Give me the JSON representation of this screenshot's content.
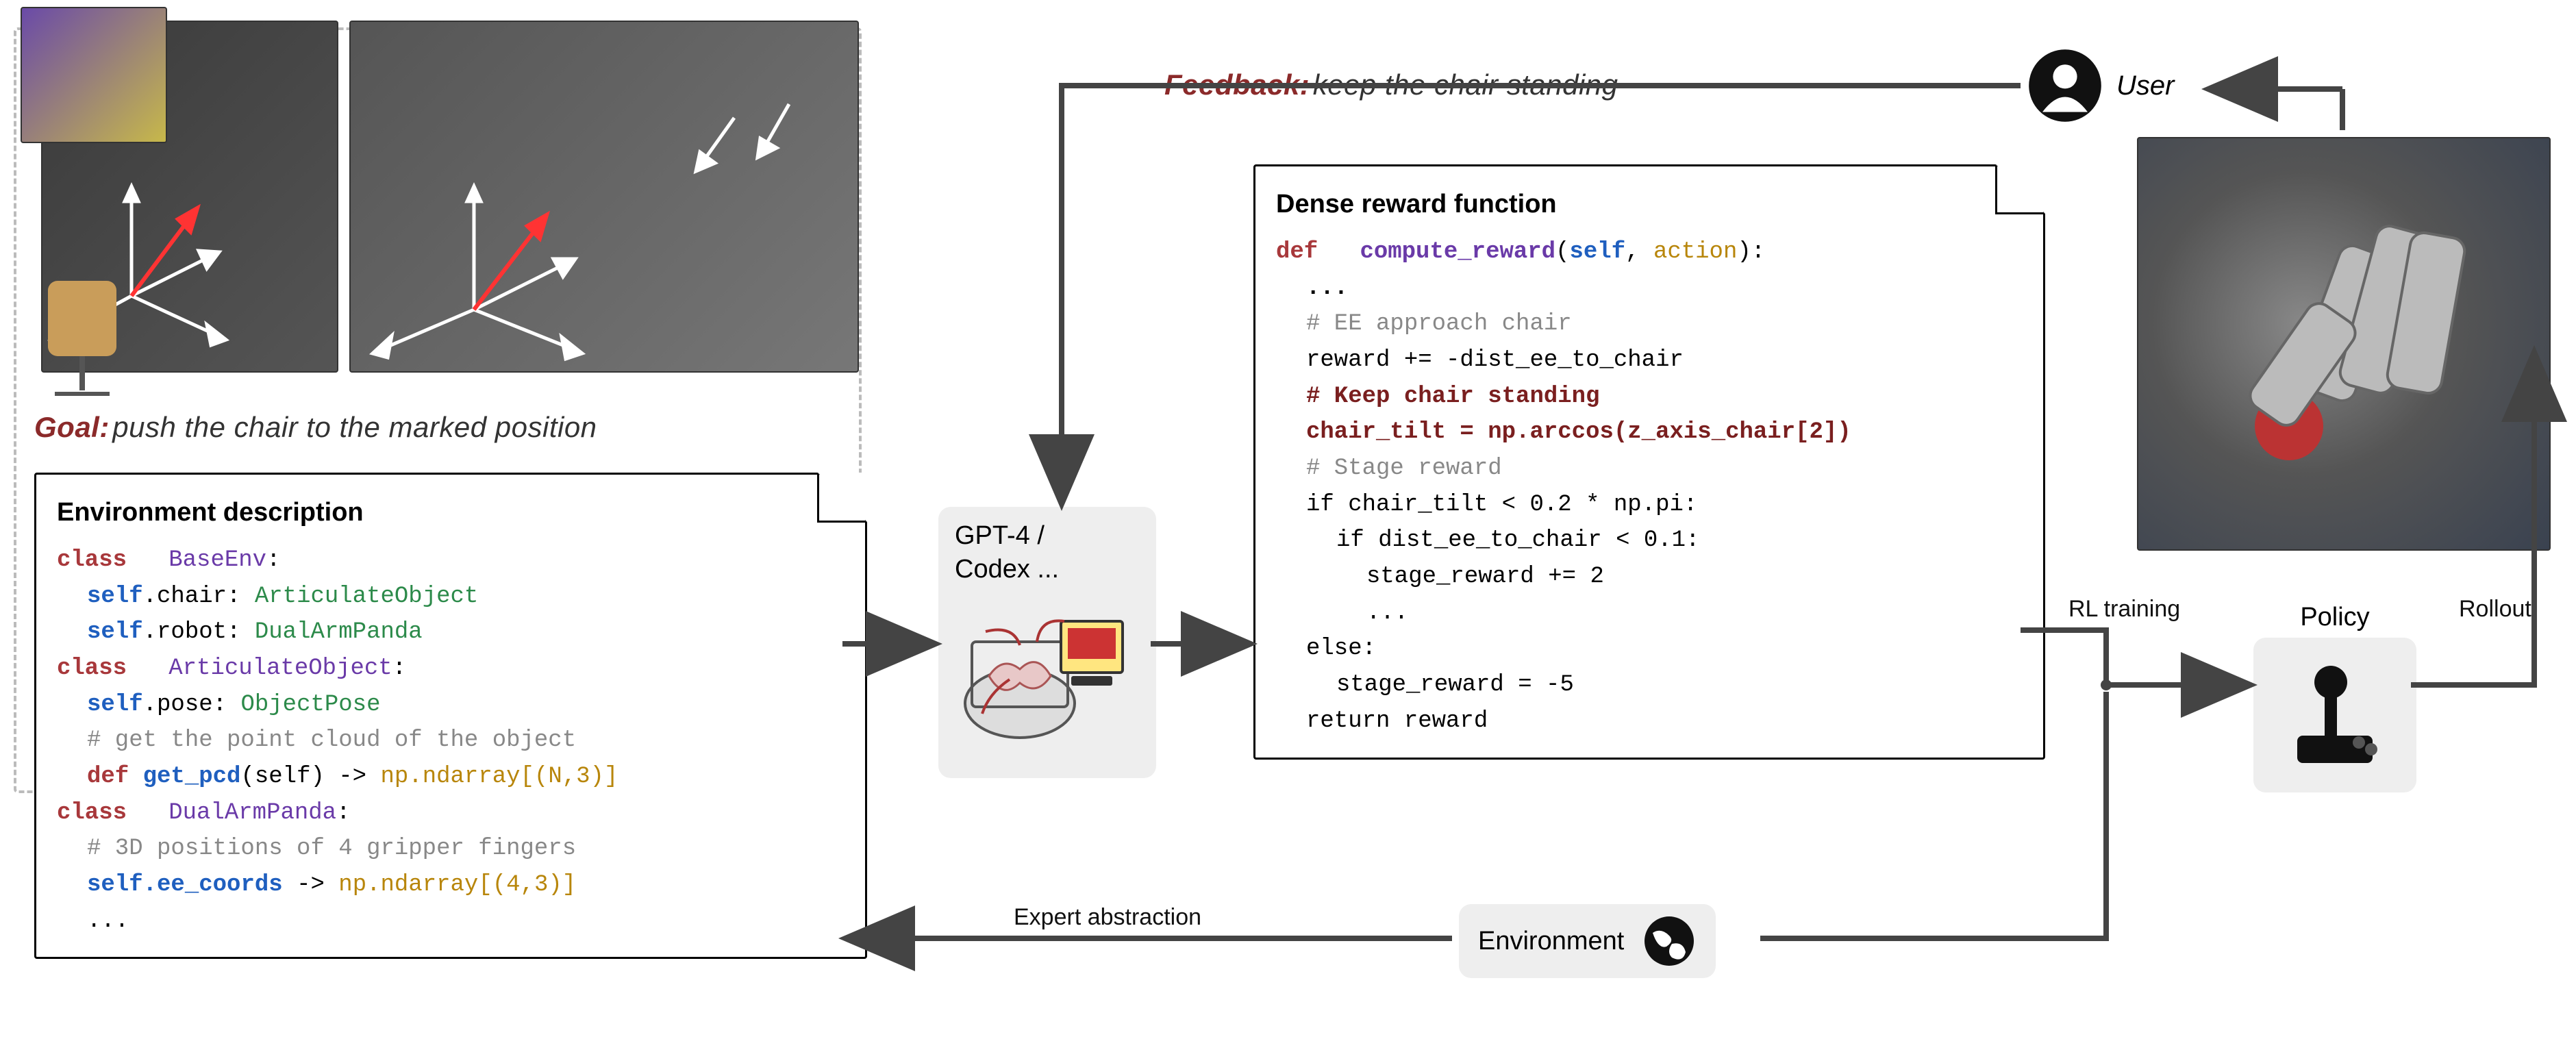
{
  "goal": {
    "label": "Goal:",
    "text": "push the chair to the marked position"
  },
  "feedback": {
    "label": "Feedback:",
    "text": "keep the chair standing"
  },
  "user_label": "User",
  "llm_box": {
    "text": "GPT-4 /\nCodex ..."
  },
  "env_label": "Environment",
  "policy_label": "Policy",
  "rl_label": "RL training",
  "rollout_label": "Rollout",
  "expert_label": "Expert abstraction",
  "env_card": {
    "title": "Environment description",
    "l1_kw": "class",
    "l1_name": "BaseEnv",
    "l1_colon": ":",
    "l2_self": "self",
    "l2_attr": ".chair:",
    "l2_type": "ArticulateObject",
    "l3_self": "self",
    "l3_attr": ".robot:",
    "l3_type": "DualArmPanda",
    "l4_kw": "class",
    "l4_name": "ArticulateObject",
    "l4_colon": ":",
    "l5_self": "self",
    "l5_attr": ".pose:",
    "l5_type": "ObjectPose",
    "l6_comment": "# get the point cloud of the object",
    "l7_def": "def",
    "l7_fn": "get_pcd",
    "l7_args": "(self)",
    "l7_arrow": " -> ",
    "l7_ret": "np.ndarray[(N,3)]",
    "l8_kw": "class",
    "l8_name": "DualArmPanda",
    "l8_colon": ":",
    "l9_comment": "# 3D positions of 4 gripper fingers",
    "l10_self": "self",
    "l10_attr": ".ee_coords",
    "l10_arrow": " -> ",
    "l10_ret": "np.ndarray[(4,3)]",
    "l11": "..."
  },
  "reward_card": {
    "title": "Dense reward function",
    "l1_def": "def",
    "l1_fn": "compute_reward",
    "l1_open": "(",
    "l1_self": "self",
    "l1_comma": ", ",
    "l1_arg": "action",
    "l1_close": "):",
    "l2": "...",
    "l3_comment": "# EE approach chair",
    "l4": "reward += -dist_ee_to_chair",
    "l5_comment": "# Keep chair standing",
    "l6": "chair_tilt = np.arccos(z_axis_chair[2])",
    "l7_comment": "# Stage reward",
    "l8": "if chair_tilt < 0.2 * np.pi:",
    "l9": "if dist_ee_to_chair < 0.1:",
    "l10": "stage_reward += 2",
    "l11": "...",
    "l12": "else:",
    "l13": "stage_reward = -5",
    "l14": "return reward"
  }
}
